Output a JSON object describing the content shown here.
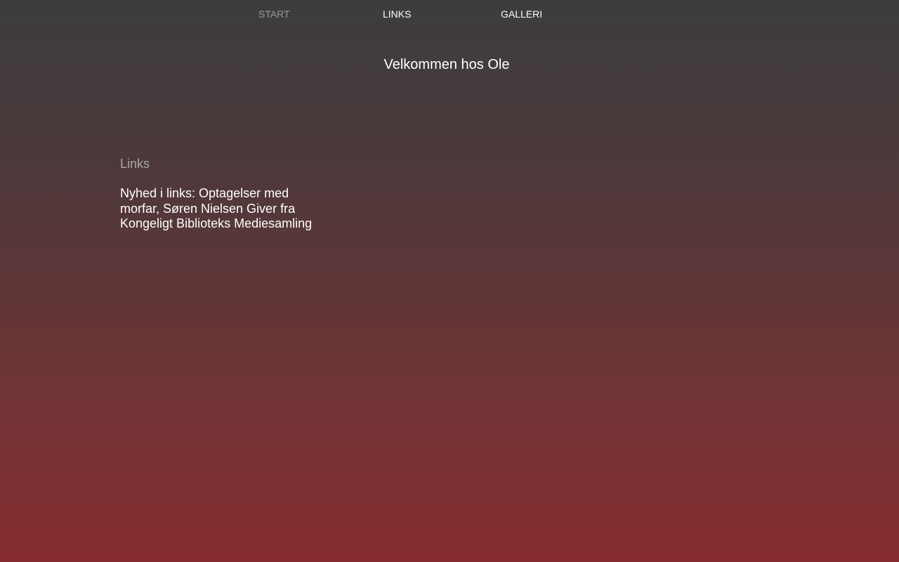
{
  "nav": {
    "items": [
      {
        "label": "START",
        "active": true
      },
      {
        "label": "LINKS",
        "active": false
      },
      {
        "label": "GALLERI",
        "active": false
      }
    ]
  },
  "main": {
    "title": "Velkommen hos Ole"
  },
  "links_section": {
    "heading": "Links",
    "news": "Nyhed i links: Optagelser med morfar, Søren Nielsen Giver fra Kongeligt Biblioteks Mediesamling"
  },
  "colors": {
    "background_top": "#3d3d3d",
    "background_bottom": "#862c2e",
    "text": "#ffffff",
    "muted_text": "#9a9a9a"
  }
}
